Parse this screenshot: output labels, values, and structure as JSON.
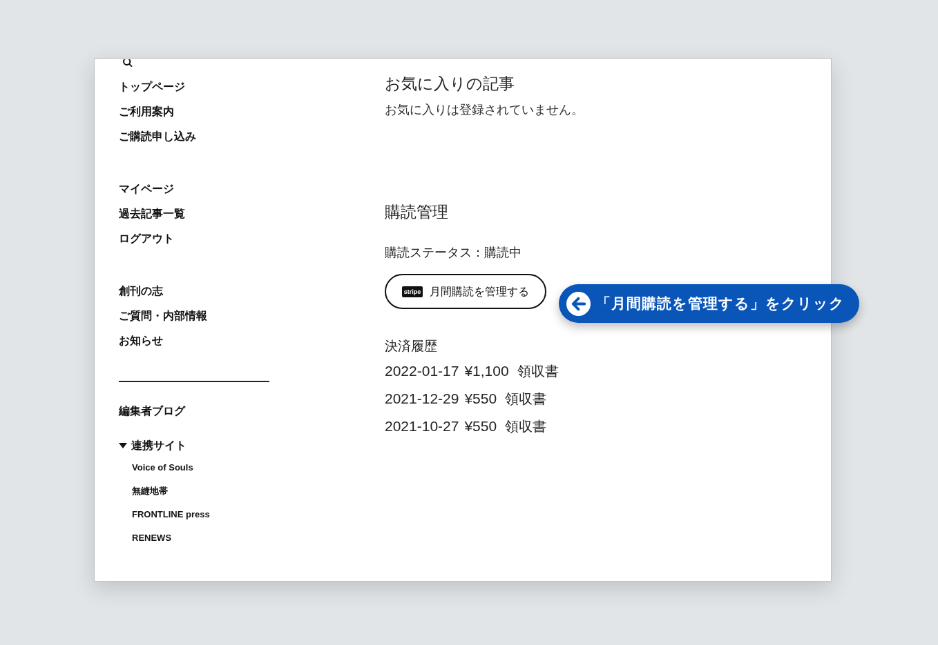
{
  "sidebar": {
    "groups": [
      {
        "items": [
          {
            "label": "トップページ"
          },
          {
            "label": "ご利用案内"
          },
          {
            "label": "ご購読申し込み"
          }
        ]
      },
      {
        "items": [
          {
            "label": "マイページ"
          },
          {
            "label": "過去記事一覧"
          },
          {
            "label": "ログアウト"
          }
        ]
      },
      {
        "items": [
          {
            "label": "創刊の志"
          },
          {
            "label": "ご質問・内部情報"
          },
          {
            "label": "お知らせ"
          }
        ]
      }
    ],
    "blog_link": "編集者ブログ",
    "partner_sites": {
      "label": "連携サイト",
      "expanded": true,
      "children": [
        {
          "label": "Voice of Souls"
        },
        {
          "label": "無縫地帯"
        },
        {
          "label": "FRONTLINE press"
        },
        {
          "label": "RENEWS"
        }
      ]
    }
  },
  "favorites": {
    "title": "お気に入りの記事",
    "message": "お気に入りは登録されていません。"
  },
  "subscription": {
    "title": "購読管理",
    "status": "購読ステータス：購読中",
    "manage_button": {
      "logo": "stripe",
      "label": "月間購読を管理する"
    }
  },
  "payments": {
    "title": "決済履歴",
    "rows": [
      {
        "date": "2022-01-17",
        "amount": "¥1,100",
        "receipt": "領収書"
      },
      {
        "date": "2021-12-29",
        "amount": "¥550",
        "receipt": "領収書"
      },
      {
        "date": "2021-10-27",
        "amount": "¥550",
        "receipt": "領収書"
      }
    ]
  },
  "callout": {
    "text": "「月間購読を管理する」をクリック"
  }
}
